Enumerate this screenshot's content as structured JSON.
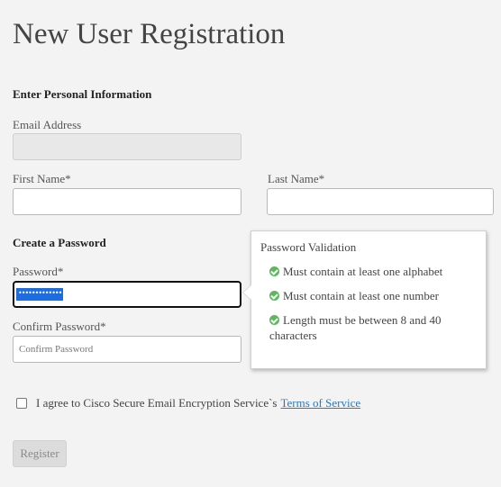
{
  "page": {
    "title": "New User Registration"
  },
  "personal": {
    "heading": "Enter Personal Information",
    "email_label": "Email Address",
    "email_value": "",
    "first_name_label": "First Name*",
    "first_name_value": "",
    "last_name_label": "Last Name*",
    "last_name_value": ""
  },
  "password": {
    "heading": "Create a Password",
    "password_label": "Password*",
    "password_value": "•••••••••••••",
    "confirm_label": "Confirm Password*",
    "confirm_placeholder": "Confirm Password"
  },
  "validation": {
    "title": "Password Validation",
    "rules": [
      "Must contain at least one alphabet",
      "Must contain at least one number",
      "Length must be between 8 and 40 characters"
    ],
    "check_color": "#5cb85c"
  },
  "agreement": {
    "text": "I agree to Cisco Secure Email Encryption Service`s",
    "link": "Terms of Service",
    "checked": false
  },
  "actions": {
    "register_label": "Register",
    "link_color": "#2a7ab8"
  }
}
